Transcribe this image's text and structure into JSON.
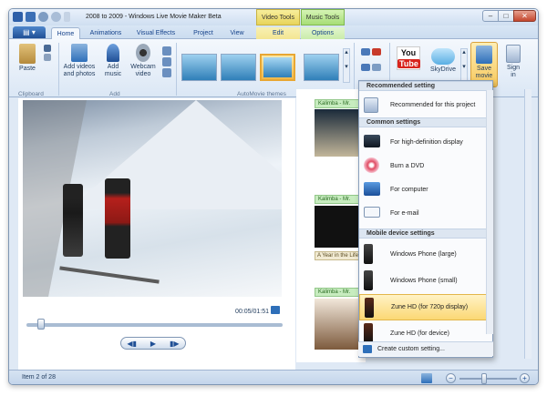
{
  "title_bar": {
    "title": "2008 to 2009 - Windows Live Movie Maker Beta",
    "context_video": "Video Tools",
    "context_music": "Music Tools"
  },
  "tabs": [
    "Home",
    "Animations",
    "Visual Effects",
    "Project",
    "View",
    "Edit",
    "Options"
  ],
  "ribbon": {
    "clipboard": {
      "paste": "Paste",
      "group": "Clipboard"
    },
    "add": {
      "add_videos_1": "Add videos",
      "add_videos_2": "and photos",
      "add_music_1": "Add",
      "add_music_2": "music",
      "webcam_1": "Webcam",
      "webcam_2": "video",
      "group": "Add"
    },
    "themes": {
      "group": "AutoMovie themes"
    },
    "share": {
      "youtube": "You",
      "youtube_b": "Tube",
      "skydrive": "SkyDrive"
    },
    "save_movie_1": "Save",
    "save_movie_2": "movie",
    "sign_in_1": "Sign",
    "sign_in_2": "in"
  },
  "player": {
    "time": "00:05/01:51"
  },
  "storyboard": {
    "clip_label": "Kalimba - Mr.",
    "caption": "Year in the Life"
  },
  "save_menu": {
    "recommended_header": "Recommended setting",
    "recommended_item": "Recommended for this project",
    "common_header": "Common settings",
    "common_items": [
      "For high-definition display",
      "Burn a DVD",
      "For computer",
      "For e-mail"
    ],
    "mobile_header": "Mobile device settings",
    "mobile_items": [
      "Windows Phone (large)",
      "Windows Phone (small)",
      "Zune HD (for 720p display)",
      "Zune HD (for device)"
    ],
    "custom": "Create custom setting..."
  },
  "status": {
    "item": "Item 2 of 28"
  }
}
